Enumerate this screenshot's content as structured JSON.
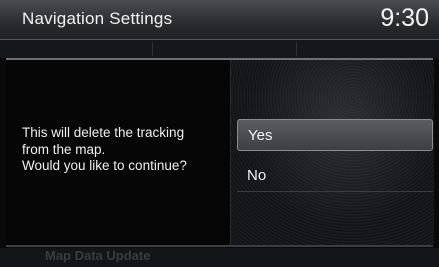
{
  "header": {
    "title": "Navigation Settings",
    "clock": "9:30"
  },
  "dialog": {
    "message_lines": [
      "This will delete the tracking",
      "from the map.",
      "Would you like to continue?"
    ],
    "options": [
      {
        "label": "Yes",
        "selected": true
      },
      {
        "label": "No",
        "selected": false
      }
    ]
  },
  "background": {
    "bottom_item": "Map Data Update"
  }
}
